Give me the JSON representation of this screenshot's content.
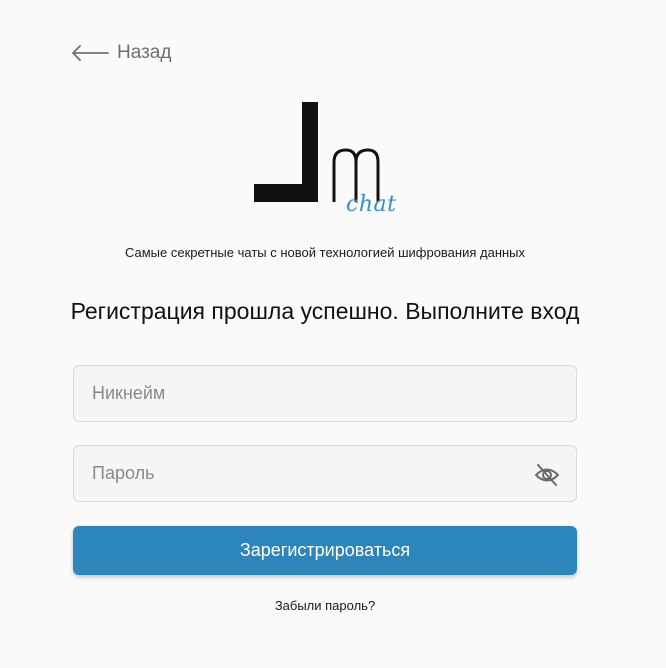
{
  "back": {
    "label": "Назад",
    "icon": "arrow-left-icon"
  },
  "logo": {
    "letters": "Jm",
    "subtitle": "chat",
    "accent_color": "#3b8fc4"
  },
  "tagline": "Самые секретные чаты с новой технологией шифрования данных",
  "heading": "Регистрация прошла успешно. Выполните вход",
  "form": {
    "nickname": {
      "placeholder": "Никнейм",
      "value": ""
    },
    "password": {
      "placeholder": "Пароль",
      "value": "",
      "toggle_icon": "eye-off-icon"
    },
    "submit_label": "Зарегистрироваться",
    "submit_color": "#2d86bb"
  },
  "forgot_password": "Забыли пароль?"
}
